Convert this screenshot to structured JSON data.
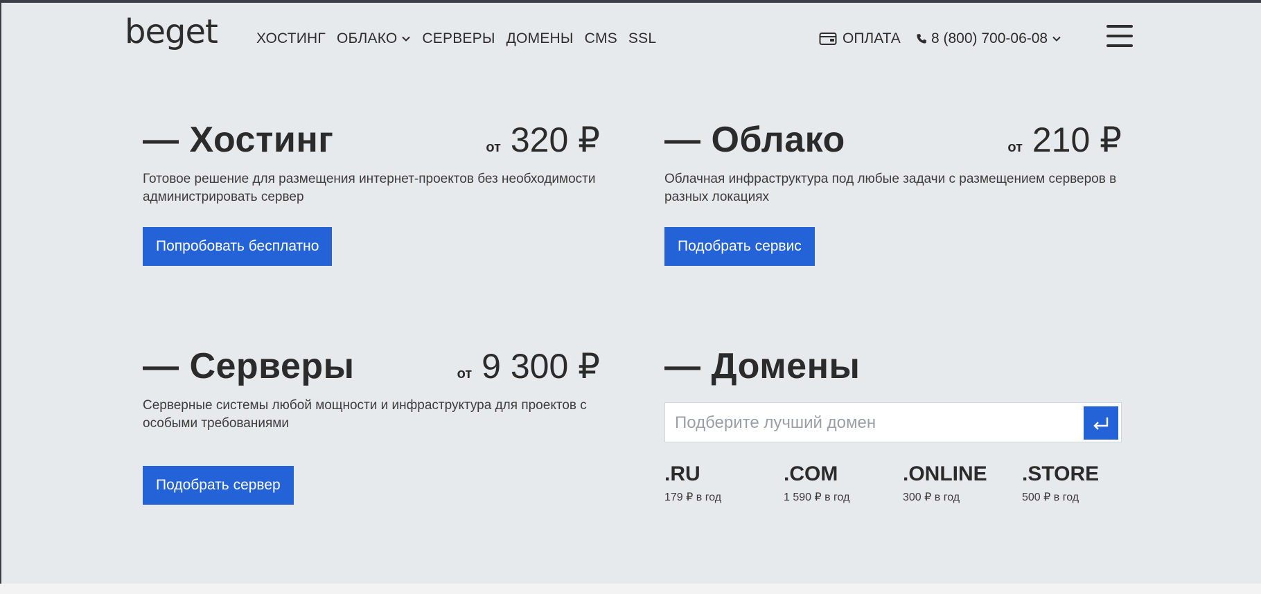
{
  "header": {
    "logo": "beget",
    "nav": [
      {
        "label": "ХОСТИНГ"
      },
      {
        "label": "ОБЛАКО"
      },
      {
        "label": "СЕРВЕРЫ"
      },
      {
        "label": "ДОМЕНЫ"
      },
      {
        "label": "CMS"
      },
      {
        "label": "SSL"
      }
    ],
    "payment_label": "ОПЛАТА",
    "phone": "8 (800) 700-06-08"
  },
  "cards": {
    "hosting": {
      "title": "— Хостинг",
      "from": "от",
      "price": "320 ₽",
      "desc": "Готовое решение для размещения интернет-проектов без необходимости администрировать сервер",
      "button": "Попробовать бесплатно"
    },
    "cloud": {
      "title": "— Облако",
      "from": "от",
      "price": "210 ₽",
      "desc": "Облачная инфраструктура под любые задачи с размещением серверов в разных локациях",
      "button": "Подобрать сервис"
    },
    "servers": {
      "title": "— Серверы",
      "from": "от",
      "price": "9 300 ₽",
      "desc": "Серверные системы любой мощности и инфраструктура для проектов с особыми требованиями",
      "button": "Подобрать сервер"
    },
    "domains": {
      "title": "— Домены",
      "search_placeholder": "Подберите лучший домен",
      "zones": [
        {
          "name": ".RU",
          "price": "179 ₽ в год"
        },
        {
          "name": ".COM",
          "price": "1 590 ₽ в год"
        },
        {
          "name": ".ONLINE",
          "price": "300 ₽ в год"
        },
        {
          "name": ".STORE",
          "price": "500 ₽ в год"
        }
      ]
    }
  },
  "colors": {
    "accent": "#2462d8",
    "background": "#e7eaed",
    "text": "#2b2b2b"
  }
}
